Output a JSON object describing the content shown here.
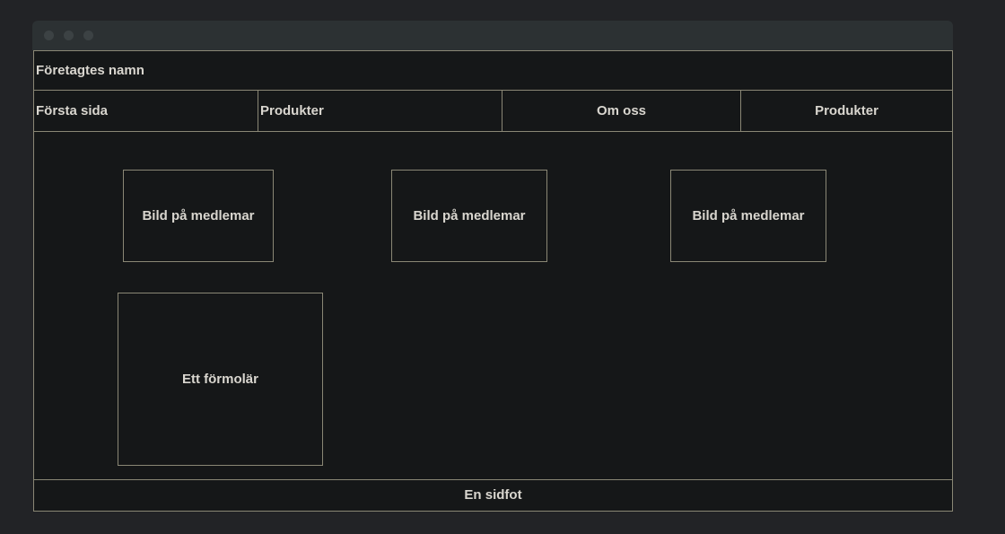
{
  "header": {
    "company_name": "Företagtes namn"
  },
  "nav": {
    "items": [
      {
        "label": "Första sida"
      },
      {
        "label": "Produkter"
      },
      {
        "label": "Om oss"
      },
      {
        "label": "Produkter"
      }
    ]
  },
  "main": {
    "member_images": [
      {
        "label": "Bild på medlemar"
      },
      {
        "label": "Bild på medlemar"
      },
      {
        "label": "Bild på medlemar"
      }
    ],
    "form": {
      "label": "Ett förmolär"
    }
  },
  "footer": {
    "label": "En sidfot"
  }
}
